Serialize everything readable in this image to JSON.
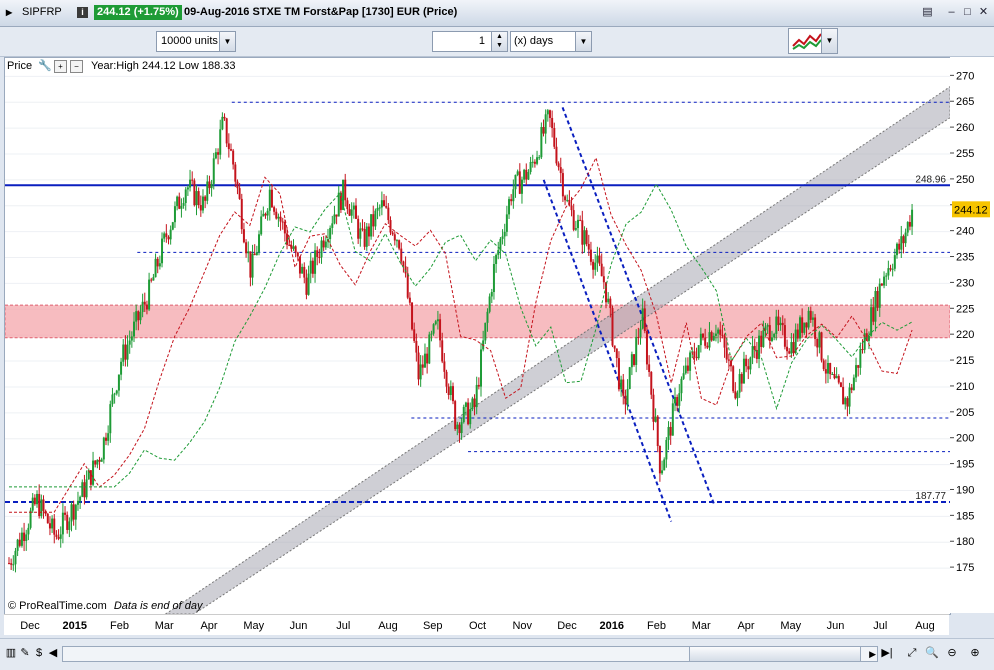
{
  "titlebar": {
    "symbol": "SIPFRP",
    "price_change": "244.12 (+1.75%)",
    "description": "09-Aug-2016 STXE TM Forst&Pap [1730] EUR (Price)",
    "info_label": "i"
  },
  "toolbar": {
    "units_value": "10000 units",
    "period_value": "1",
    "period_unit": "(x) days"
  },
  "legend": {
    "price_label": "Price",
    "stats": "Year:High 244.12 Low 188.33"
  },
  "footer": {
    "brand": "© ProRealTime.com",
    "note": "Data is end of day"
  },
  "colors": {
    "up": "#1e9b36",
    "down": "#c4131c",
    "resistance": "#0a1fbf",
    "zone": "#f4a6ab",
    "channel": "#a7a7b2"
  },
  "chart_data": {
    "type": "candlestick",
    "y_ticks": [
      175,
      180,
      185,
      190,
      195,
      200,
      205,
      210,
      215,
      220,
      225,
      230,
      235,
      240,
      245,
      250,
      255,
      260,
      265,
      270
    ],
    "ylim": [
      170,
      272
    ],
    "x_ticks": [
      "Dec",
      "2015",
      "Feb",
      "Mar",
      "Apr",
      "May",
      "Jun",
      "Jul",
      "Aug",
      "Sep",
      "Oct",
      "Nov",
      "Dec",
      "2016",
      "Feb",
      "Mar",
      "Apr",
      "May",
      "Jun",
      "Jul",
      "Aug"
    ],
    "horizontal_levels": [
      {
        "value": 248.96,
        "label": "248.96",
        "style": "solid"
      },
      {
        "value": 187.77,
        "label": "187.77",
        "style": "dashed"
      }
    ],
    "last_price": "244.12",
    "support_zone": [
      219.5,
      225.8
    ],
    "close_path": [
      [
        0,
        176
      ],
      [
        0.03,
        188
      ],
      [
        0.05,
        181
      ],
      [
        0.08,
        190
      ],
      [
        0.1,
        198
      ],
      [
        0.12,
        215
      ],
      [
        0.15,
        228
      ],
      [
        0.17,
        240
      ],
      [
        0.19,
        249
      ],
      [
        0.21,
        245
      ],
      [
        0.23,
        261
      ],
      [
        0.24,
        254
      ],
      [
        0.26,
        232
      ],
      [
        0.28,
        248
      ],
      [
        0.3,
        238
      ],
      [
        0.32,
        230
      ],
      [
        0.34,
        240
      ],
      [
        0.36,
        248
      ],
      [
        0.38,
        238
      ],
      [
        0.4,
        245
      ],
      [
        0.42,
        238
      ],
      [
        0.44,
        212
      ],
      [
        0.46,
        222
      ],
      [
        0.48,
        203
      ],
      [
        0.5,
        206
      ],
      [
        0.52,
        232
      ],
      [
        0.54,
        248
      ],
      [
        0.56,
        252
      ],
      [
        0.58,
        262
      ],
      [
        0.6,
        245
      ],
      [
        0.62,
        238
      ],
      [
        0.64,
        230
      ],
      [
        0.66,
        206
      ],
      [
        0.68,
        224
      ],
      [
        0.7,
        194
      ],
      [
        0.72,
        210
      ],
      [
        0.74,
        218
      ],
      [
        0.76,
        222
      ],
      [
        0.78,
        210
      ],
      [
        0.8,
        217
      ],
      [
        0.82,
        222
      ],
      [
        0.84,
        218
      ],
      [
        0.86,
        225
      ],
      [
        0.88,
        212
      ],
      [
        0.9,
        207
      ],
      [
        0.92,
        220
      ],
      [
        0.94,
        232
      ],
      [
        0.96,
        238
      ],
      [
        0.97,
        244.12
      ]
    ]
  }
}
